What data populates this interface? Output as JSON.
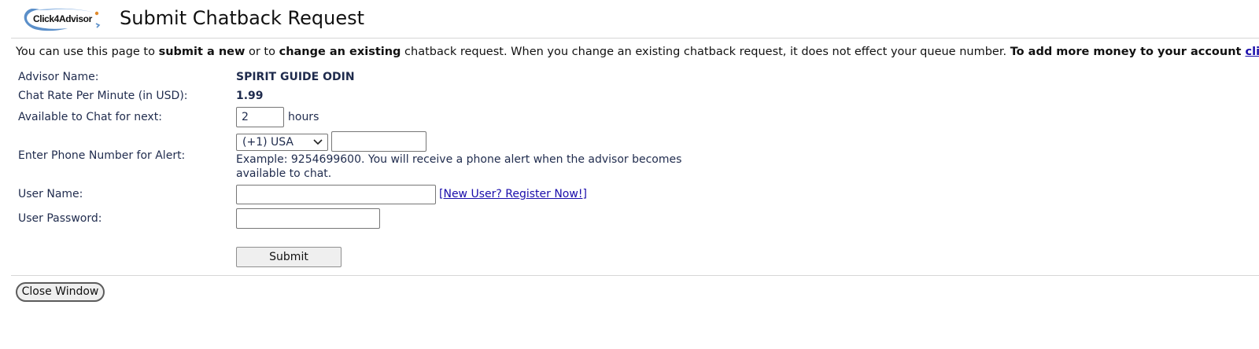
{
  "header": {
    "logo_text": "Click4Advisor",
    "title": "Submit Chatback Request"
  },
  "intro": {
    "part1": "You can use this page to ",
    "bold1": "submit a new",
    "part2": " or to ",
    "bold2": "change an existing",
    "part3": " chatback request. When you change an existing chatback request, it does not effect your queue number. ",
    "bold3": "To add more money to your account ",
    "link": "click here",
    "end": "."
  },
  "form": {
    "advisor_name_label": "Advisor Name:",
    "advisor_name_value": "SPIRIT GUIDE ODIN",
    "chat_rate_label": "Chat Rate Per Minute (in USD):",
    "chat_rate_value": "1.99",
    "available_label": "Available to Chat for next:",
    "available_value": "2",
    "available_unit": "hours",
    "phone_label": "Enter Phone Number for Alert:",
    "country_selected": "(+1) USA",
    "phone_value": "",
    "phone_hint": "Example: 9254699600. You will receive a phone alert when the advisor becomes available to chat.",
    "username_label": "User Name:",
    "username_value": "",
    "register_prefix": "[",
    "register_link": "New User? Register Now!",
    "register_suffix": "]",
    "password_label": "User Password:",
    "password_value": "",
    "submit_label": "Submit"
  },
  "footer": {
    "close_label": "Close Window"
  },
  "colors": {
    "text": "#1f2b4d",
    "link": "#1a0dab",
    "logo_swoosh": "#5b8fc9",
    "logo_dot": "#e08a2c"
  }
}
